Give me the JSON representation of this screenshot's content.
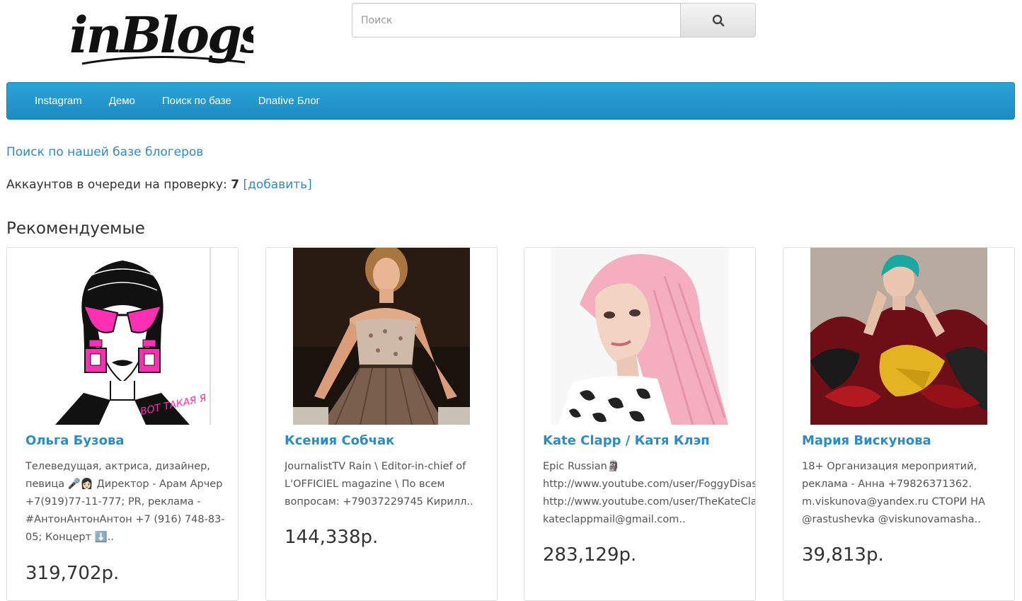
{
  "brand": {
    "logo_text": "inBlogs"
  },
  "search": {
    "placeholder": "Поиск"
  },
  "nav": {
    "items": [
      {
        "label": "Instagram"
      },
      {
        "label": "Демо"
      },
      {
        "label": "Поиск по базе"
      },
      {
        "label": "Dnative Блог"
      }
    ]
  },
  "main": {
    "search_link": "Поиск по нашей базе блогеров",
    "queue_label": "Аккаунтов в очереди на проверку:",
    "queue_count": "7",
    "queue_add": "[добавить]",
    "section_title": "Рекомендуемые"
  },
  "cards": [
    {
      "name": "Ольга Бузова",
      "description": "Телеведущая, актриса, дизайнер,\nпевица 🎤👩🏻 Директор - Арам Арчер\n+7(919)77-11-777; PR, реклама -\n#АнтонАнтонАнтон +7 (916) 748-83-\n05; Концерт ⬇️..",
      "price": "319,702р.",
      "image_caption": "ВОТ ТАКАЯ Я"
    },
    {
      "name": "Ксения Собчак",
      "description": "JournalistTV Rain \\ Editor-in-chief of\nL'OFFICIEL magazine \\ По всем\nвопросам: +79037229745 Кирилл..",
      "price": "144,338р."
    },
    {
      "name": "Kate Clapp / Катя Клэп",
      "description": "Epic Russian🗿\nhttp://www.youtube.com/user/FoggyDisast\nhttp://www.youtube.com/user/TheKateClap\nkateclappmail@gmail.com..",
      "price": "283,129р."
    },
    {
      "name": "Мария Вискунова",
      "description": "18+ Организация мероприятий,\nреклама - Анна +79826371362.\nm.viskunova@yandex.ru СТОРИ НА\n@rastushevka @viskunovamasha..",
      "price": "39,813р."
    }
  ],
  "colors": {
    "navbar": "#2aa4d8",
    "link": "#2a8dc8",
    "text": "#333333"
  }
}
